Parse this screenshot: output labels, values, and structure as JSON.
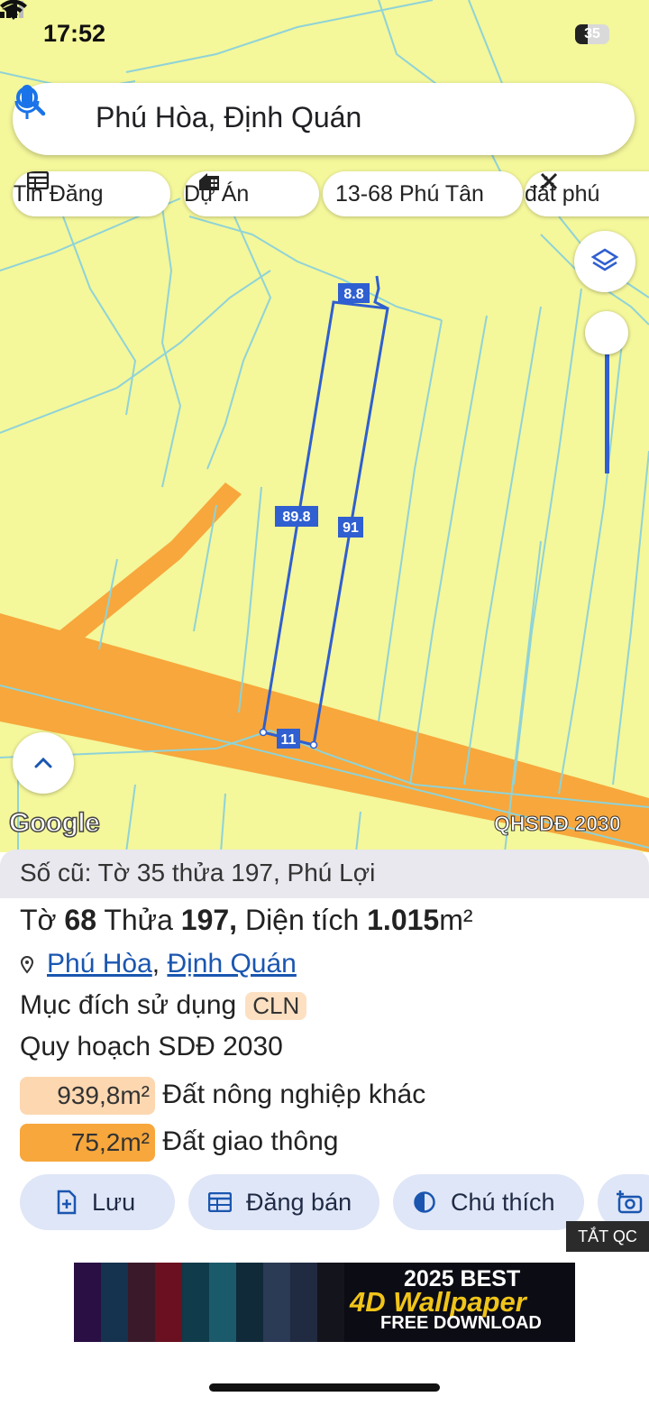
{
  "status_bar": {
    "time": "17:52",
    "battery": "35"
  },
  "search": {
    "query": "Phú Hòa, Định Quán"
  },
  "chips": [
    {
      "label": "Tin Đăng",
      "icon": "table-icon"
    },
    {
      "label": "Dự Án",
      "icon": "building-icon"
    },
    {
      "label": "13-68 Phú Tân",
      "icon": ""
    },
    {
      "label": "đất phú",
      "icon": "ruler-icon"
    }
  ],
  "map": {
    "edge_labels": {
      "top": "8.8",
      "left": "89.8",
      "right": "91",
      "bottom": "11"
    },
    "watermark": "Google",
    "layer_label": "QHSDĐ 2030"
  },
  "panel": {
    "old_info": "Số cũ: Tờ 35 thửa 197, Phú Lợi",
    "title": {
      "to_label": "Tờ",
      "to_num": "68",
      "thua_label": "Thửa",
      "thua_num": "197,",
      "dt_label": "Diện tích",
      "dt_value": "1.015",
      "unit": "m²"
    },
    "location": {
      "ward": "Phú Hòa",
      "sep": ",",
      "district": "Định Quán"
    },
    "purpose_label": "Mục đích sử dụng",
    "purpose_code": "CLN",
    "plan_label": "Quy hoạch SDĐ 2030",
    "plan_items": [
      {
        "area": "939,8m²",
        "label": "Đất nông nghiệp khác",
        "color": "#fcd7b0"
      },
      {
        "area": "75,2m²",
        "label": "Đất giao thông",
        "color": "#f7a73c"
      }
    ],
    "actions": [
      {
        "label": "Lưu",
        "icon": "add-doc-icon"
      },
      {
        "label": "Đăng bán",
        "icon": "table-icon"
      },
      {
        "label": "Chú thích",
        "icon": "contrast-icon"
      },
      {
        "label": "",
        "icon": "add-camera-icon"
      }
    ],
    "ad_close": "TẮT QC",
    "ad": {
      "line1": "2025 BEST",
      "line2": "4D Wallpaper",
      "line3": "FREE DOWNLOAD"
    }
  },
  "colors": {
    "map_bg": "#f4f79a",
    "road": "#f7a73c",
    "parcel_line": "#8fd3d8",
    "selected": "#2f5fd0",
    "button_bg": "#dfe6f7"
  }
}
